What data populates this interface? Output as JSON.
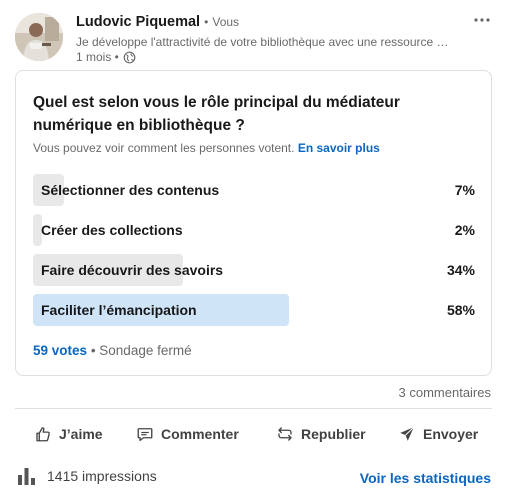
{
  "author": {
    "name": "Ludovic Piquemal",
    "separator": "•",
    "relation": "Vous",
    "headline": "Je développe l'attractivité de votre bibliothèque avec une ressource …",
    "time": "1 mois •"
  },
  "poll": {
    "question": "Quel est selon vous le rôle principal du médiateur numérique en bibliothèque ?",
    "visibility_text": "Vous pouvez voir comment les personnes votent.",
    "learn_more": "En savoir plus",
    "options": [
      {
        "label": "Sélectionner des contenus",
        "percent": 7,
        "percent_label": "7%",
        "selected": false
      },
      {
        "label": "Créer des collections",
        "percent": 2,
        "percent_label": "2%",
        "selected": false
      },
      {
        "label": "Faire découvrir des savoirs",
        "percent": 34,
        "percent_label": "34%",
        "selected": false
      },
      {
        "label": "Faciliter l’émancipation",
        "percent": 58,
        "percent_label": "58%",
        "selected": true
      }
    ],
    "votes": "59 votes",
    "status": "• Sondage fermé"
  },
  "social": {
    "comments": "3 commentaires"
  },
  "actions": {
    "like": "J’aime",
    "comment": "Commenter",
    "repost": "Republier",
    "send": "Envoyer"
  },
  "analytics": {
    "impressions": "1415 impressions",
    "view_stats": "Voir les statistiques"
  },
  "icons": {
    "globe": "globe-icon",
    "more": "more-options-icon",
    "like": "thumbs-up-icon",
    "comment": "comment-icon",
    "repost": "repost-icon",
    "send": "send-icon",
    "analytics": "bar-chart-icon"
  },
  "colors": {
    "link": "#0a66c2",
    "bar": "#e8e8e8",
    "bar_selected": "#d0e4f7"
  }
}
